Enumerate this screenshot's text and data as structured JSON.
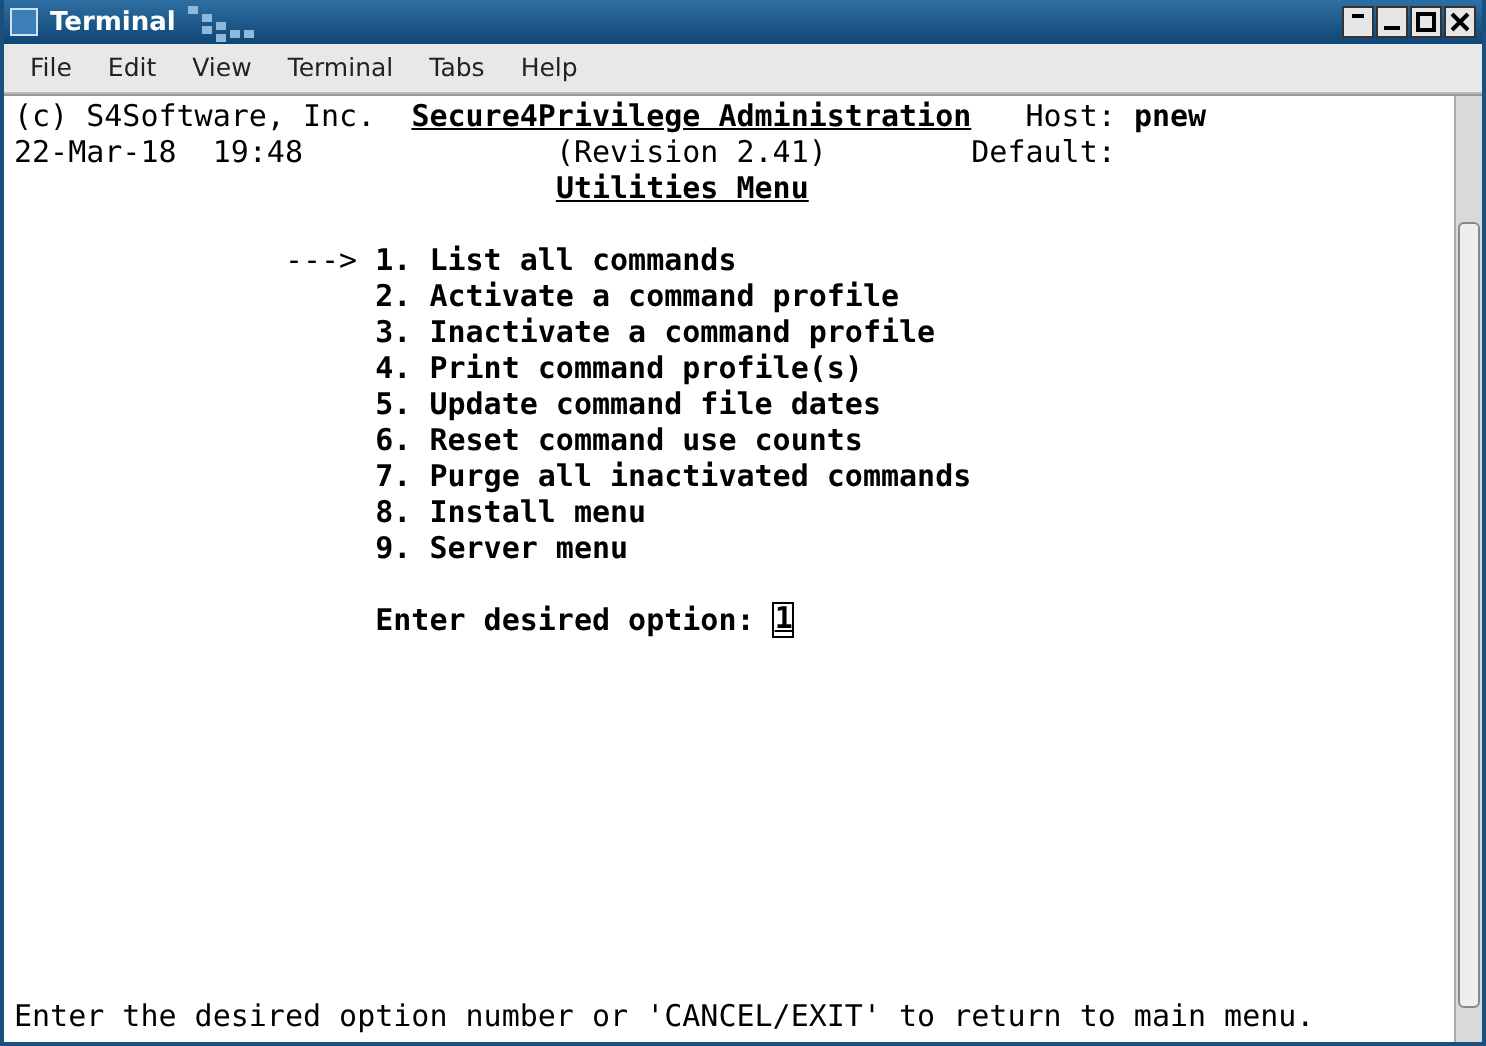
{
  "window": {
    "title": "Terminal"
  },
  "menu": [
    "File",
    "Edit",
    "View",
    "Terminal",
    "Tabs",
    "Help"
  ],
  "terminal": {
    "company": "(c) S4Software, Inc.",
    "product": "Secure4Privilege Administration",
    "host_label": "Host:",
    "host": "pnew",
    "date": "22-Mar-18",
    "time": "19:48",
    "revision": "(Revision 2.41)",
    "default_label": "Default:",
    "menu_title": "Utilities Menu",
    "pointer": "--->",
    "options": [
      {
        "number": "1.",
        "label": "List all commands",
        "selected": true
      },
      {
        "number": "2.",
        "label": "Activate a command profile",
        "selected": false
      },
      {
        "number": "3.",
        "label": "Inactivate a command profile",
        "selected": false
      },
      {
        "number": "4.",
        "label": "Print command profile(s)",
        "selected": false
      },
      {
        "number": "5.",
        "label": "Update command file dates",
        "selected": false
      },
      {
        "number": "6.",
        "label": "Reset command use counts",
        "selected": false
      },
      {
        "number": "7.",
        "label": "Purge all inactivated commands",
        "selected": false
      },
      {
        "number": "8.",
        "label": "Install menu",
        "selected": false
      },
      {
        "number": "9.",
        "label": "Server menu",
        "selected": false
      }
    ],
    "prompt": "Enter desired option:",
    "input": "1",
    "status_line": "Enter the desired option number or 'CANCEL/EXIT' to return to main menu."
  }
}
